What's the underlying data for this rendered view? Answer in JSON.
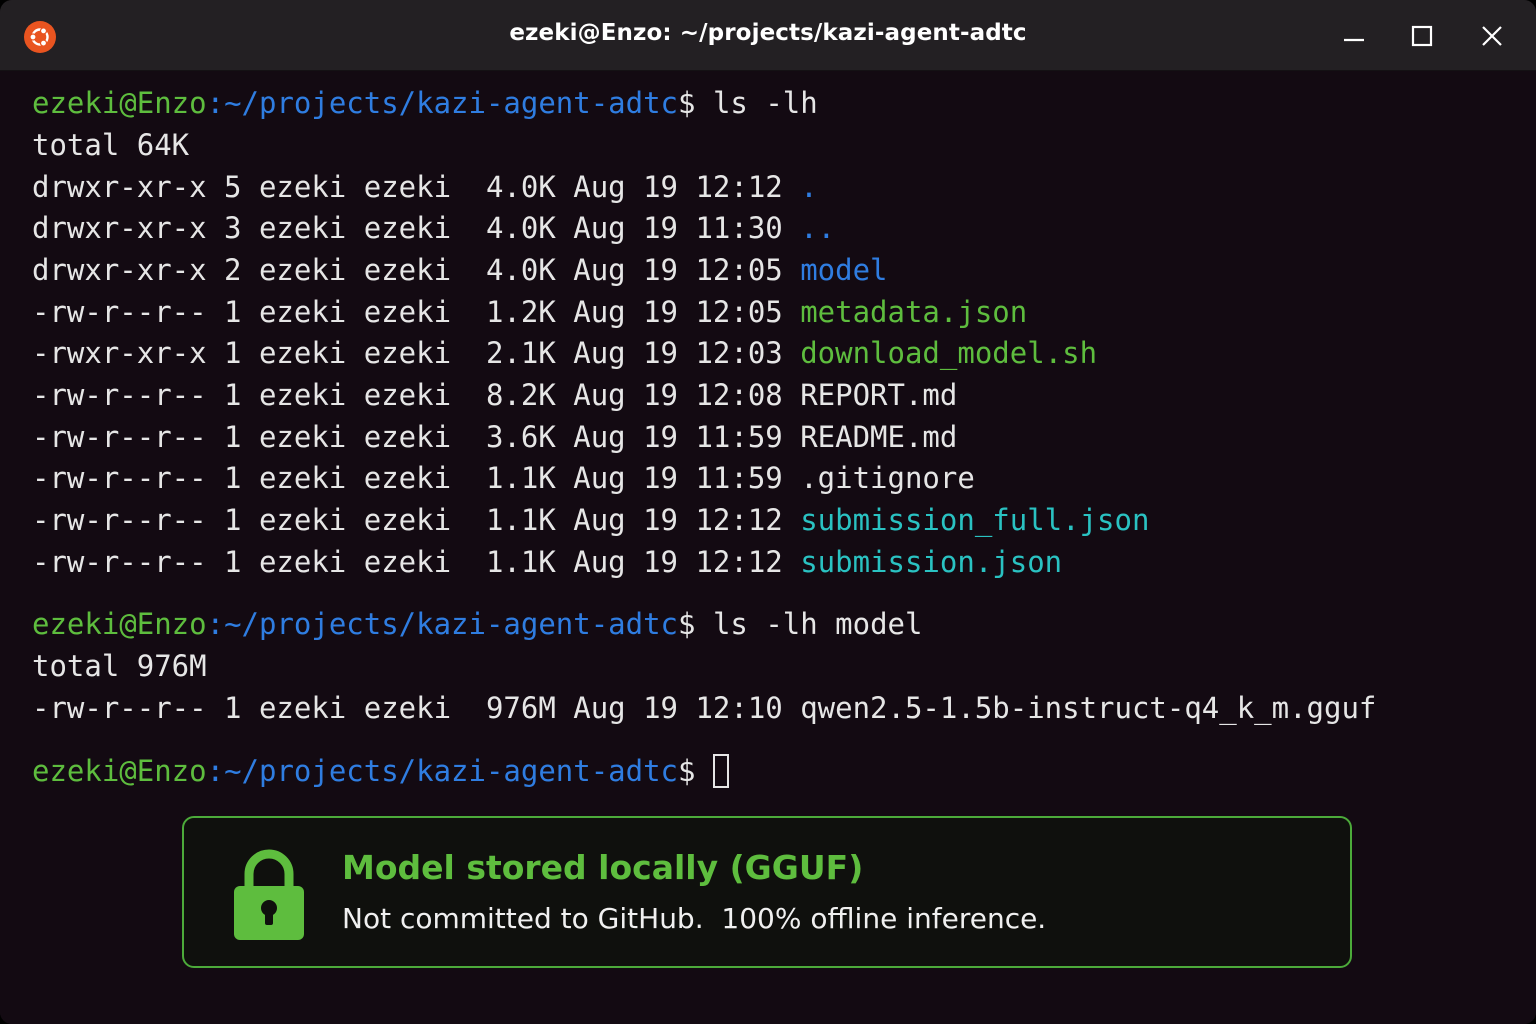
{
  "window": {
    "title": "ezeki@Enzo: ~/projects/kazi-agent-adtc",
    "icon": "ubuntu-logo-icon",
    "controls": [
      "minimize-icon",
      "maximize-icon",
      "close-icon"
    ]
  },
  "prompt": {
    "user_host": "ezeki@Enzo",
    "path": ":~/projects/kazi-agent-adtc",
    "symbol": "$"
  },
  "commands": [
    {
      "command": " ls -lh",
      "total": "total 64K",
      "entries": [
        {
          "meta": "drwxr-xr-x 5 ezeki ezeki  4.0K Aug 19 12:12 ",
          "name": ".",
          "kind": "dir"
        },
        {
          "meta": "drwxr-xr-x 3 ezeki ezeki  4.0K Aug 19 11:30 ",
          "name": "..",
          "kind": "dir"
        },
        {
          "meta": "drwxr-xr-x 2 ezeki ezeki  4.0K Aug 19 12:05 ",
          "name": "model",
          "kind": "dir"
        },
        {
          "meta": "-rw-r--r-- 1 ezeki ezeki  1.2K Aug 19 12:05 ",
          "name": "metadata.json",
          "kind": "exe"
        },
        {
          "meta": "-rwxr-xr-x 1 ezeki ezeki  2.1K Aug 19 12:03 ",
          "name": "download_model.sh",
          "kind": "exe"
        },
        {
          "meta": "-rw-r--r-- 1 ezeki ezeki  8.2K Aug 19 12:08 ",
          "name": "REPORT.md",
          "kind": "file"
        },
        {
          "meta": "-rw-r--r-- 1 ezeki ezeki  3.6K Aug 19 11:59 ",
          "name": "README.md",
          "kind": "file"
        },
        {
          "meta": "-rw-r--r-- 1 ezeki ezeki  1.1K Aug 19 11:59 ",
          "name": ".gitignore",
          "kind": "file"
        },
        {
          "meta": "-rw-r--r-- 1 ezeki ezeki  1.1K Aug 19 12:12 ",
          "name": "submission_full.json",
          "kind": "hl"
        },
        {
          "meta": "-rw-r--r-- 1 ezeki ezeki  1.1K Aug 19 12:12 ",
          "name": "submission.json",
          "kind": "hl"
        }
      ]
    },
    {
      "command": " ls -lh model",
      "total": "total 976M",
      "entries": [
        {
          "meta": "-rw-r--r-- 1 ezeki ezeki  976M Aug 19 12:10 ",
          "name": "qwen2.5-1.5b-instruct-q4_k_m.gguf",
          "kind": "file"
        }
      ]
    }
  ],
  "banner": {
    "icon": "lock-icon",
    "title": "Model stored locally (GGUF)",
    "subtitle": "Not committed to GitHub.  100% offline inference."
  },
  "colors": {
    "user_host": "#5ebd3e",
    "path": "#2f7de1",
    "directory": "#2f7de1",
    "executable": "#5ebd3e",
    "highlight": "#2ac2c2",
    "background": "#130a12",
    "banner_accent": "#5ebd3e"
  }
}
